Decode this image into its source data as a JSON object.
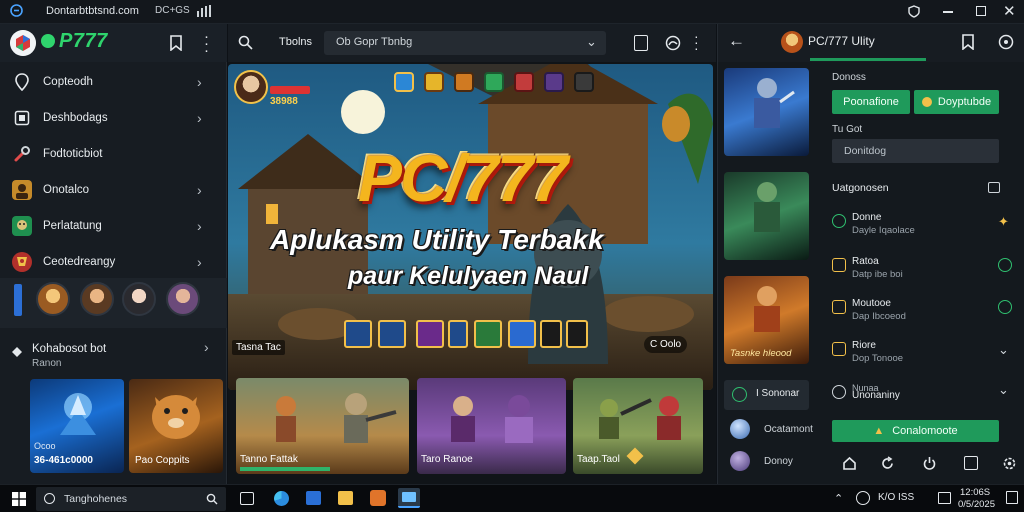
{
  "titlebar": {
    "title": "Dontarbtbtsnd.com",
    "tab2": "DC+GS"
  },
  "sidebar": {
    "brand": "P777",
    "items": [
      {
        "label": "Copteodh"
      },
      {
        "label": "Deshbodags"
      },
      {
        "label": "Fodtoticbiot"
      },
      {
        "label": "Onotalco"
      },
      {
        "label": "Perlatatung"
      },
      {
        "label": "Ceotedreangy"
      }
    ],
    "section_title": "Kohabosot bot",
    "section_sub": "Ranon",
    "cards": [
      {
        "line1": "Ocoo",
        "line2": "36-461c0000"
      },
      {
        "line1": "Pao Coppits",
        "line2": ""
      }
    ]
  },
  "main": {
    "tab_label": "Tbolns",
    "search_text": "Ob Gopr Tbnbg",
    "hero": {
      "logo": "PC/777",
      "headline": "Aplukasm Utility Terbakk",
      "subheadline": "paur Kelulyaen Naul",
      "score_left": "38988",
      "badge_left": "Tasna Tac",
      "badge_right": "C Oolo"
    },
    "game_cards": [
      {
        "label": "Tanno Fattak"
      },
      {
        "label": "Taro Ranoe"
      },
      {
        "label": "Taap.Taol"
      }
    ]
  },
  "rpanel": {
    "title": "PC/777 Ulity",
    "left_list": [
      {
        "label": "Tasnke hleood"
      },
      {
        "label": "I Sononar"
      },
      {
        "label": "Ocatamont"
      },
      {
        "label": "Donoy"
      }
    ],
    "section1_label": "Donoss",
    "btn_primary": "Poonafione",
    "btn_secondary": "Doyptubde",
    "section2_label": "Tu Got",
    "field_placeholder": "Donitdog",
    "section3_label": "Uatgonosen",
    "list": [
      {
        "name": "Donne",
        "sub": "Dayle Iqaolace"
      },
      {
        "name": "Ratoa",
        "sub": "Datp ibe boi"
      },
      {
        "name": "Moutooe",
        "sub": "Dap Ibcoeod"
      },
      {
        "name": "Riore",
        "sub": "Dop Tonooe"
      },
      {
        "name": "Nunaa",
        "sub": "Unonaniny"
      }
    ],
    "footer_btn": "Conalomoote"
  },
  "taskbar": {
    "search_placeholder": "Tanghohenes",
    "tray_text": "K/O ISS",
    "time": "12:06S",
    "date": "0/5/2025"
  },
  "colors": {
    "accent": "#1f9a5b",
    "brand": "#2fd46d",
    "background": "#0d1116"
  }
}
